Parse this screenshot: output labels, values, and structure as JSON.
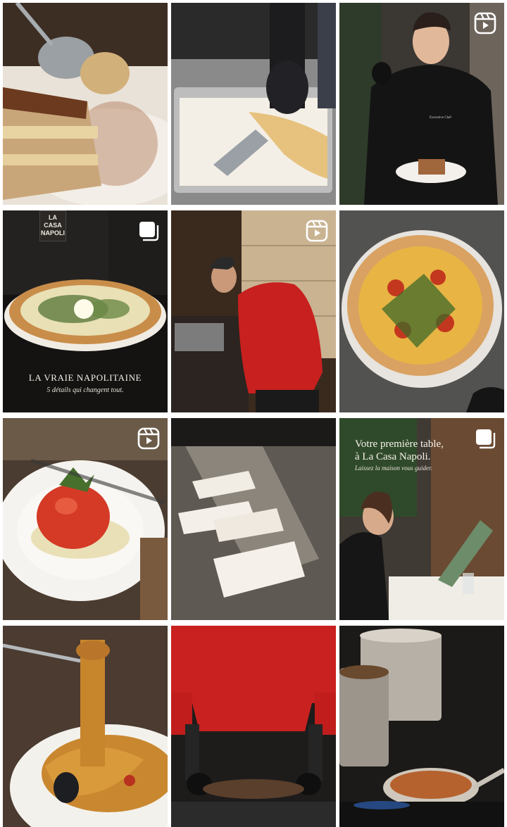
{
  "feed": {
    "posts": [
      {
        "id": "tiramisu",
        "type": "image",
        "alt_subject": "tiramisu"
      },
      {
        "id": "tray",
        "type": "image"
      },
      {
        "id": "chef",
        "type": "reel",
        "chef_coat": "Executive Chef"
      },
      {
        "id": "vraie-napolitaine",
        "type": "carousel",
        "title": "LA VRAIE NAPOLITAINE",
        "subtitle": "5 détails qui changent tout.",
        "logo_line1": "LA CASA",
        "logo_line2": "NAPOLI"
      },
      {
        "id": "pizzaiolo",
        "type": "reel"
      },
      {
        "id": "pizza",
        "type": "image"
      },
      {
        "id": "tomato",
        "type": "reel"
      },
      {
        "id": "tickets",
        "type": "image"
      },
      {
        "id": "premiere-table",
        "type": "carousel",
        "title_line1": "Votre première table,",
        "title_line2": "à La Casa Napoli.",
        "subtitle": "Laissez la maison vous guider."
      },
      {
        "id": "pasta",
        "type": "image"
      },
      {
        "id": "red-chef",
        "type": "image"
      },
      {
        "id": "kitchen",
        "type": "image"
      }
    ]
  },
  "icons": {
    "reel": "reels-icon",
    "carousel": "carousel-icon"
  },
  "colors": {
    "background": "#ffffff",
    "overlay_text": "#f3efe6"
  }
}
